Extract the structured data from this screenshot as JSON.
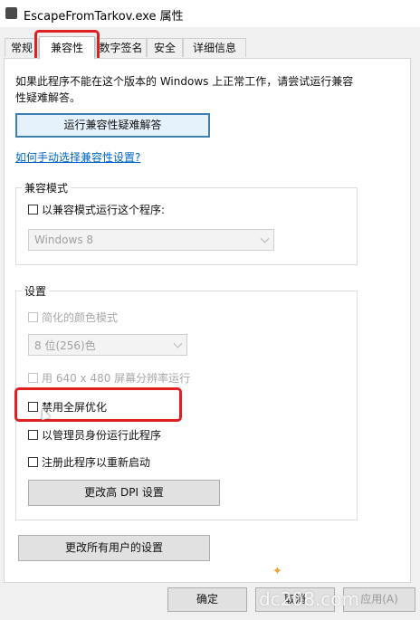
{
  "window": {
    "title": "EscapeFromTarkov.exe 属性",
    "icon": "app-icon"
  },
  "tabs": [
    "常规",
    "兼容性",
    "数字签名",
    "安全",
    "详细信息"
  ],
  "active_tab": "兼容性",
  "description": "如果此程序不能在这个版本的 Windows 上正常工作，请尝试运行兼容性疑难解答。",
  "troubleshoot_button": "运行兼容性疑难解答",
  "manual_link": "如何手动选择兼容性设置?",
  "compat_mode": {
    "group_label": "兼容模式",
    "checkbox_label": "以兼容模式运行这个程序:",
    "checked": false,
    "os_select_value": "Windows 8"
  },
  "settings": {
    "group_label": "设置",
    "reduced_color": "简化的颜色模式",
    "color_select_value": "8 位(256)色",
    "run_640": "用 640 x 480 屏幕分辨率运行",
    "disable_fullscreen_opt": "禁用全屏优化",
    "run_as_admin": "以管理员身份运行此程序",
    "register_restart": "注册此程序以重新启动",
    "dpi_button": "更改高 DPI 设置"
  },
  "all_users_button": "更改所有用户的设置",
  "footer": {
    "ok": "确定",
    "cancel": "取消",
    "apply": "应用(A)"
  },
  "watermark": "dc208.com",
  "colors": {
    "highlight_red": "#e02020",
    "link_blue": "#0066cc",
    "focus_blue": "#3c7fb1"
  }
}
